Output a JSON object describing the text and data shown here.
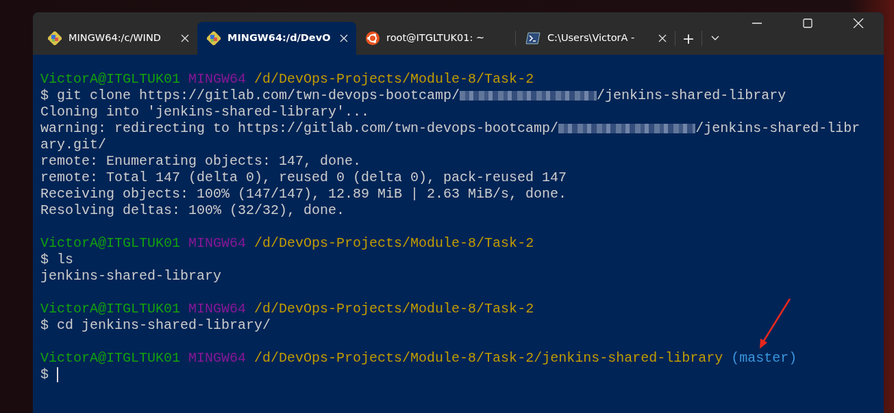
{
  "tabs": [
    {
      "label": "MINGW64:/c/WIND",
      "kind": "bash",
      "selected": false,
      "closable": true
    },
    {
      "label": "MINGW64:/d/DevO",
      "kind": "bash",
      "selected": true,
      "closable": true
    },
    {
      "label": "root@ITGLTUK01: ~",
      "kind": "linux",
      "selected": false,
      "closable": false
    },
    {
      "label": "C:\\Users\\VictorA -",
      "kind": "shell",
      "selected": false,
      "closable": true
    }
  ],
  "new_tab": "+",
  "terminal": {
    "lines": [
      {
        "kind": "text",
        "segments": [
          {
            "kind": "user",
            "text": "VictorA@ITGLTUK01"
          },
          {
            "kind": "system",
            "text": "MINGW64"
          },
          {
            "kind": "path",
            "text": "/d/DevOps-Projects/Module-8/Task-2"
          }
        ]
      },
      {
        "kind": "text",
        "segments": [
          {
            "kind": "plain",
            "text": "$ git clone https://gitlab.com/twn-devops-bootcamp/"
          },
          {
            "kind": "redacted"
          },
          {
            "kind": "plain",
            "text": "/jenkins-shared-library"
          }
        ]
      },
      {
        "kind": "text",
        "segments": [
          {
            "kind": "plain",
            "text": "Cloning into 'jenkins-shared-library'..."
          }
        ]
      },
      {
        "kind": "text",
        "segments": [
          {
            "kind": "plain",
            "text": "warning: redirecting to https://gitlab.com/twn-devops-bootcamp/"
          },
          {
            "kind": "redacted"
          },
          {
            "kind": "plain",
            "text": "/jenkins-shared-libr"
          }
        ]
      },
      {
        "kind": "text",
        "segments": [
          {
            "kind": "plain",
            "text": "ary.git/"
          }
        ]
      },
      {
        "kind": "text",
        "segments": [
          {
            "kind": "plain",
            "text": "remote: Enumerating objects: 147, done."
          }
        ]
      },
      {
        "kind": "text",
        "segments": [
          {
            "kind": "plain",
            "text": "remote: Total 147 (delta 0), reused 0 (delta 0), pack-reused 147"
          }
        ]
      },
      {
        "kind": "text",
        "segments": [
          {
            "kind": "plain",
            "text": "Receiving objects: 100% (147/147), 12.89 MiB | 2.63 MiB/s, done."
          }
        ]
      },
      {
        "kind": "text",
        "segments": [
          {
            "kind": "plain",
            "text": "Resolving deltas: 100% (32/32), done."
          }
        ]
      },
      {
        "kind": "blank"
      },
      {
        "kind": "text",
        "segments": [
          {
            "kind": "user",
            "text": "VictorA@ITGLTUK01"
          },
          {
            "kind": "system",
            "text": "MINGW64"
          },
          {
            "kind": "path",
            "text": "/d/DevOps-Projects/Module-8/Task-2"
          }
        ]
      },
      {
        "kind": "text",
        "segments": [
          {
            "kind": "plain",
            "text": "$ ls"
          }
        ]
      },
      {
        "kind": "text",
        "segments": [
          {
            "kind": "plain",
            "text": "jenkins-shared-library"
          }
        ]
      },
      {
        "kind": "blank"
      },
      {
        "kind": "text",
        "segments": [
          {
            "kind": "user",
            "text": "VictorA@ITGLTUK01"
          },
          {
            "kind": "system",
            "text": "MINGW64"
          },
          {
            "kind": "path",
            "text": "/d/DevOps-Projects/Module-8/Task-2"
          }
        ]
      },
      {
        "kind": "text",
        "segments": [
          {
            "kind": "plain",
            "text": "$ cd jenkins-shared-library/"
          }
        ]
      },
      {
        "kind": "blank"
      },
      {
        "kind": "text",
        "segments": [
          {
            "kind": "user",
            "text": "VictorA@ITGLTUK01"
          },
          {
            "kind": "system",
            "text": "MINGW64"
          },
          {
            "kind": "path",
            "text": "/d/DevOps-Projects/Module-8/Task-2/jenkins-shared-library"
          },
          {
            "kind": "branch",
            "text": "(master)"
          }
        ]
      },
      {
        "kind": "text",
        "segments": [
          {
            "kind": "plain",
            "text": "$"
          },
          {
            "kind": "cursor"
          }
        ]
      }
    ]
  }
}
